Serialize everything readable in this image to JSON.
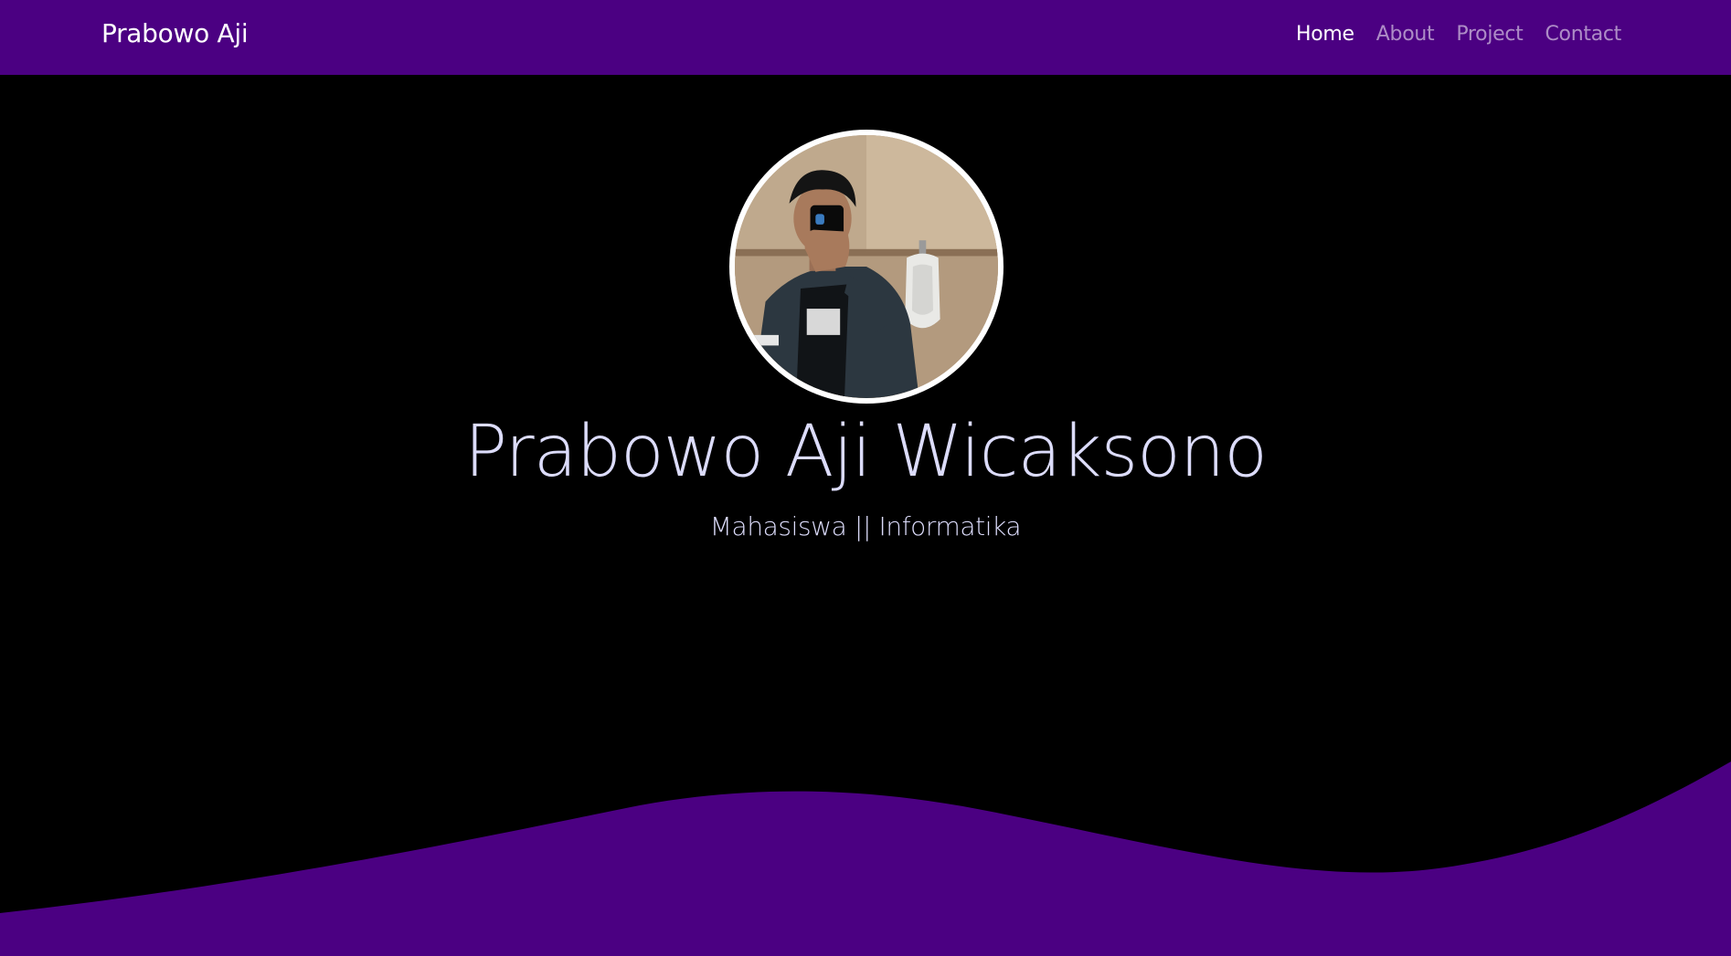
{
  "navbar": {
    "brand": "Prabowo Aji",
    "links": [
      {
        "label": "Home",
        "active": true
      },
      {
        "label": "About",
        "active": false
      },
      {
        "label": "Project",
        "active": false
      },
      {
        "label": "Contact",
        "active": false
      }
    ]
  },
  "hero": {
    "name": "Prabowo Aji Wicaksono",
    "subtitle": "Mahasiswa || Informatika"
  },
  "colors": {
    "brand_purple": "#4b0082",
    "background": "#000000",
    "hero_text": "#dcdcfb"
  }
}
